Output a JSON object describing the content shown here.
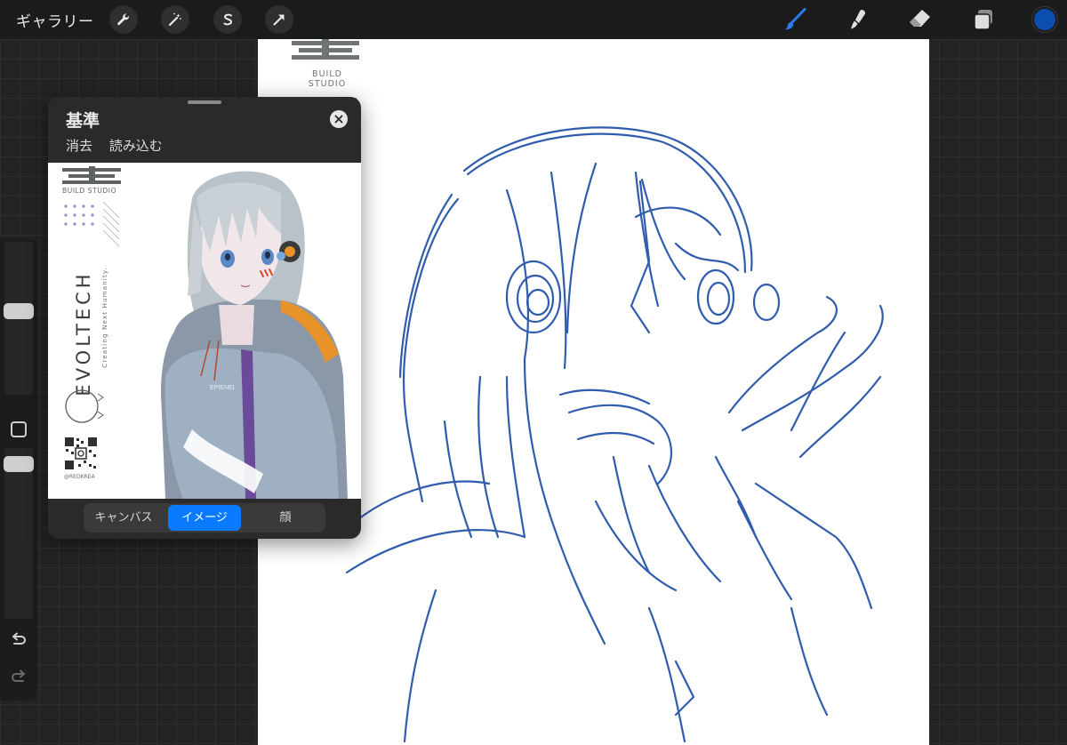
{
  "topbar": {
    "gallery_label": "ギャラリー",
    "left_tools": [
      "wrench-icon",
      "magic-wand-icon",
      "selection-icon",
      "transform-arrow-icon"
    ],
    "right_tools": [
      "brush-icon",
      "smudge-icon",
      "eraser-icon",
      "layers-icon"
    ],
    "accent_color": "#1e6bd6",
    "current_color": "#0a4fb0"
  },
  "canvas": {
    "logo_text": "BUILD STUDIO",
    "background": "#ffffff",
    "sketch_color": "#1f4fa8"
  },
  "sidebar": {
    "brush_size_level": 0.55,
    "opacity_level": 0.95,
    "undo_icon": "undo-icon",
    "redo_icon": "redo-icon"
  },
  "reference": {
    "title": "基準",
    "actions": [
      "消去",
      "読み込む"
    ],
    "image": {
      "logo_text": "BUILD STUDIO",
      "brand_text": "EVOLTECH",
      "tagline": "Creating Next Humanity.",
      "jacket_text": "EPIENEL",
      "handle": "@REDKREA"
    },
    "tabs": [
      {
        "label": "キャンバス",
        "active": false
      },
      {
        "label": "イメージ",
        "active": true
      },
      {
        "label": "顔",
        "active": false
      }
    ],
    "active_color": "#0a7aff"
  }
}
